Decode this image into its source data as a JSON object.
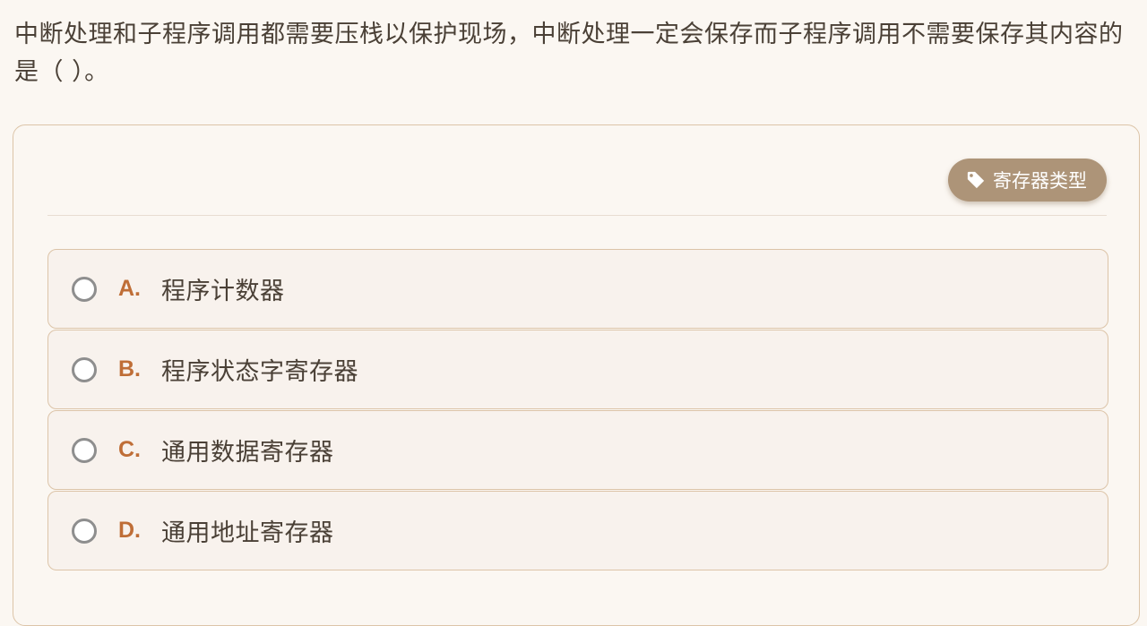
{
  "question": {
    "text": "中断处理和子程序调用都需要压栈以保护现场，中断处理一定会保存而子程序调用不需要保存其内容的是（ ）。"
  },
  "tag": {
    "icon": "tag-icon",
    "label": "寄存器类型"
  },
  "options": [
    {
      "letter": "A.",
      "text": "程序计数器"
    },
    {
      "letter": "B.",
      "text": "程序状态字寄存器"
    },
    {
      "letter": "C.",
      "text": "通用数据寄存器"
    },
    {
      "letter": "D.",
      "text": "通用地址寄存器"
    }
  ],
  "colors": {
    "accent_letter": "#bf6e37",
    "tag_bg": "#ad9478",
    "border": "#dcc4a8",
    "background": "#fbf7f2"
  }
}
